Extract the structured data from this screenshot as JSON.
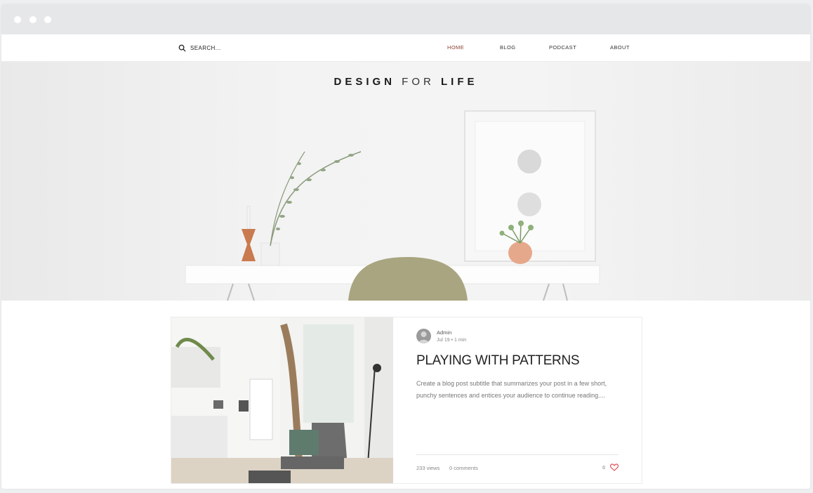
{
  "browser": {
    "dots": [
      "close",
      "minimize",
      "maximize"
    ]
  },
  "nav": {
    "search_placeholder": "SEARCH...",
    "items": [
      {
        "label": "HOME",
        "active": true
      },
      {
        "label": "BLOG",
        "active": false
      },
      {
        "label": "PODCAST",
        "active": false
      },
      {
        "label": "ABOUT",
        "active": false
      }
    ],
    "active_color": "#8b3c2c"
  },
  "hero": {
    "title_left": "DESIGN",
    "title_mid": "FOR",
    "title_right": "LIFE"
  },
  "post": {
    "author": "Admin",
    "meta": "Jul 19  •  1 min",
    "title": "PLAYING WITH PATTERNS",
    "excerpt": "Create a blog post subtitle that summarizes your post in a few short, punchy sentences and entices your audience to continue reading....",
    "views": "233 views",
    "comments": "0 comments",
    "likes": "6",
    "heart_color": "#e0525a"
  }
}
